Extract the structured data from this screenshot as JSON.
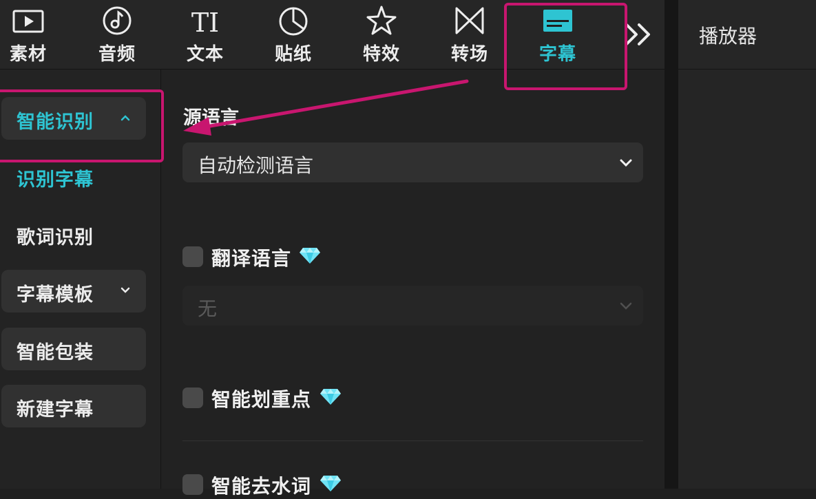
{
  "toolbar": {
    "tabs": [
      {
        "label": "素材",
        "icon": "media-icon"
      },
      {
        "label": "音频",
        "icon": "audio-icon"
      },
      {
        "label": "文本",
        "icon": "text-icon"
      },
      {
        "label": "贴纸",
        "icon": "sticker-icon"
      },
      {
        "label": "特效",
        "icon": "effects-icon"
      },
      {
        "label": "转场",
        "icon": "transition-icon"
      },
      {
        "label": "字幕",
        "icon": "subtitle-icon",
        "active": true
      }
    ],
    "more_icon": "double-chevron-right-icon"
  },
  "player": {
    "title": "播放器"
  },
  "sidebar": {
    "items": [
      {
        "label": "智能识别",
        "expanded": true,
        "active": true
      },
      {
        "label": "识别字幕",
        "active": true
      },
      {
        "label": "歌词识别"
      },
      {
        "label": "字幕模板",
        "expanded": false
      },
      {
        "label": "智能包装"
      },
      {
        "label": "新建字幕"
      }
    ]
  },
  "panel": {
    "source_language": {
      "title": "源语言",
      "value": "自动检测语言"
    },
    "translate": {
      "label": "翻译语言",
      "checked": false,
      "premium": true,
      "value": "无"
    },
    "smart_highlight": {
      "label": "智能划重点",
      "checked": false,
      "premium": true
    },
    "remove_fillers": {
      "label": "智能去水词",
      "checked": false,
      "premium": true
    }
  },
  "colors": {
    "accent": "#2ec4d2",
    "annotation": "#c8166f",
    "background": "#1f1f1f",
    "gem": "#6fe3f5"
  }
}
